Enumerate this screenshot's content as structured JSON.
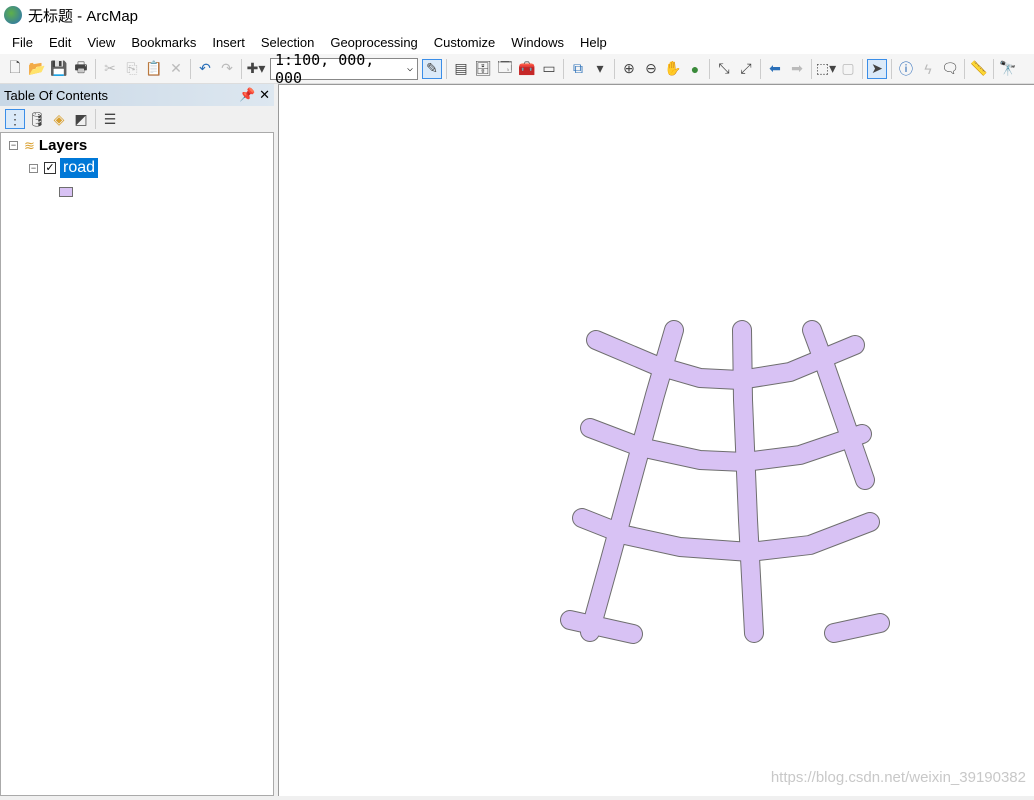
{
  "window": {
    "title": "无标题 - ArcMap"
  },
  "menu": [
    "File",
    "Edit",
    "View",
    "Bookmarks",
    "Insert",
    "Selection",
    "Geoprocessing",
    "Customize",
    "Windows",
    "Help"
  ],
  "toolbar": {
    "scale": "1:100, 000, 000"
  },
  "toc": {
    "title": "Table Of Contents",
    "root": "Layers",
    "layer": "road",
    "layer_checked": true
  },
  "map": {
    "road_fill": "#d8c2f4",
    "road_outline": "#6e6e6e"
  },
  "watermark": "https://blog.csdn.net/weixin_39190382"
}
